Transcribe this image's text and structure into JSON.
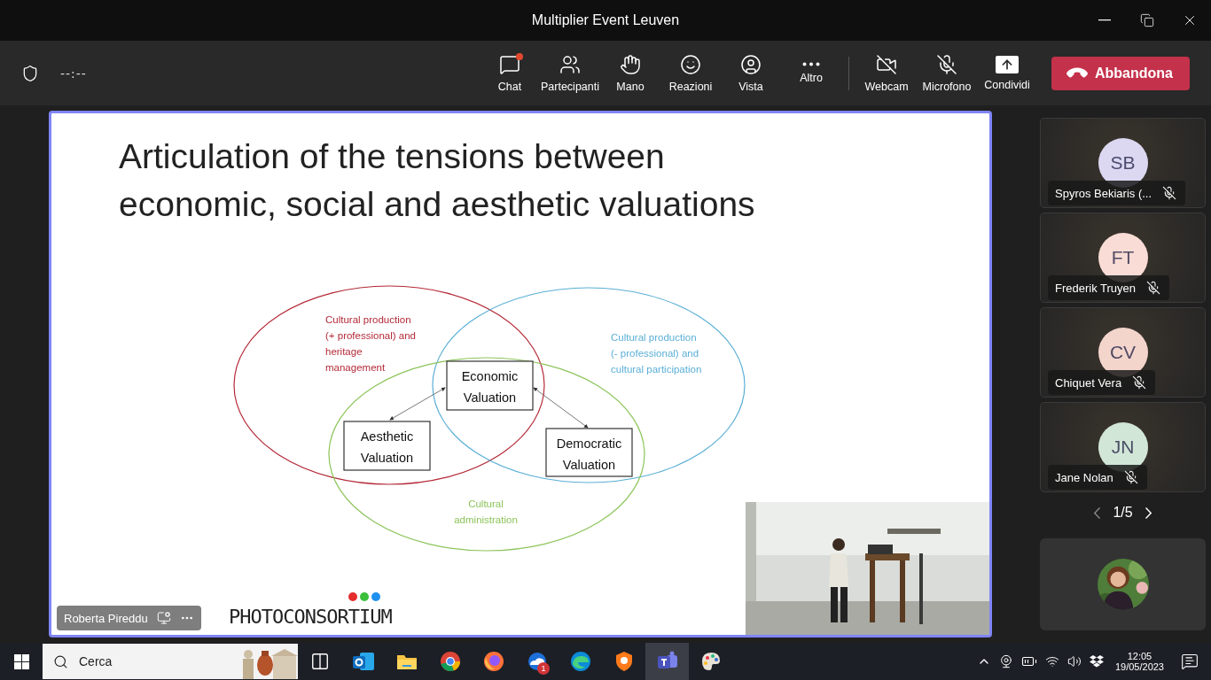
{
  "window": {
    "title": "Multiplier Event Leuven"
  },
  "toolbar": {
    "timer": "--:--",
    "buttons": [
      {
        "kind": "chat",
        "label": "Chat",
        "notification": true
      },
      {
        "kind": "people",
        "label": "Partecipanti",
        "notification": false
      },
      {
        "kind": "hand",
        "label": "Mano",
        "notification": false
      },
      {
        "kind": "reactions",
        "label": "Reazioni",
        "notification": false
      },
      {
        "kind": "view",
        "label": "Vista",
        "notification": false
      },
      {
        "kind": "more",
        "label": "Altro",
        "notification": false
      }
    ],
    "media": [
      {
        "kind": "camera",
        "label": "Webcam",
        "off": true
      },
      {
        "kind": "mic",
        "label": "Microfono",
        "off": true
      },
      {
        "kind": "share",
        "label": "Condividi"
      }
    ],
    "leave_button": "Abbandona"
  },
  "slide": {
    "title_lines": [
      "Articulation of the tensions between",
      "economic, social and aesthetic valuations"
    ],
    "circles": [
      {
        "color": "#b42a38",
        "label_lines": [
          "Cultural production",
          "(+ professional)  and",
          "heritage",
          "management"
        ]
      },
      {
        "color": "#5aafd6",
        "label_lines": [
          "Cultural production",
          "(- professional) and",
          "cultural participation"
        ]
      },
      {
        "color": "#8cc45a",
        "label_lines": [
          "Cultural",
          "administration"
        ]
      }
    ],
    "boxes": [
      {
        "lines": [
          "Economic",
          "Valuation"
        ]
      },
      {
        "lines": [
          "Aesthetic",
          "Valuation"
        ]
      },
      {
        "lines": [
          "Democratic",
          "Valuation"
        ]
      }
    ],
    "logo": "PHOTOCONSORTIUM",
    "speaker": "Roberta Pireddu"
  },
  "participants": [
    {
      "initials": "SB",
      "name": "Spyros Bekiaris (...",
      "color": "#dcd8f2",
      "muted": true
    },
    {
      "initials": "FT",
      "name": "Frederik Truyen",
      "color": "#f9dcd5",
      "muted": true
    },
    {
      "initials": "CV",
      "name": "Chiquet Vera",
      "color": "#f3d5cc",
      "muted": true
    },
    {
      "initials": "JN",
      "name": "Jane Nolan",
      "color": "#d2e6d7",
      "muted": true
    }
  ],
  "pager": "1/5",
  "taskbar": {
    "search_placeholder": "Cerca",
    "apps": [
      {
        "kind": "taskview",
        "active": false
      },
      {
        "kind": "outlook",
        "active": false
      },
      {
        "kind": "folder",
        "active": false
      },
      {
        "kind": "chrome",
        "active": false
      },
      {
        "kind": "firefox",
        "active": false
      },
      {
        "kind": "mail",
        "active": false,
        "badge": "1"
      },
      {
        "kind": "edge",
        "active": false
      },
      {
        "kind": "shield",
        "active": false
      },
      {
        "kind": "teams",
        "active": true
      },
      {
        "kind": "paint",
        "active": false
      }
    ],
    "time": "12:05",
    "date": "19/05/2023"
  }
}
